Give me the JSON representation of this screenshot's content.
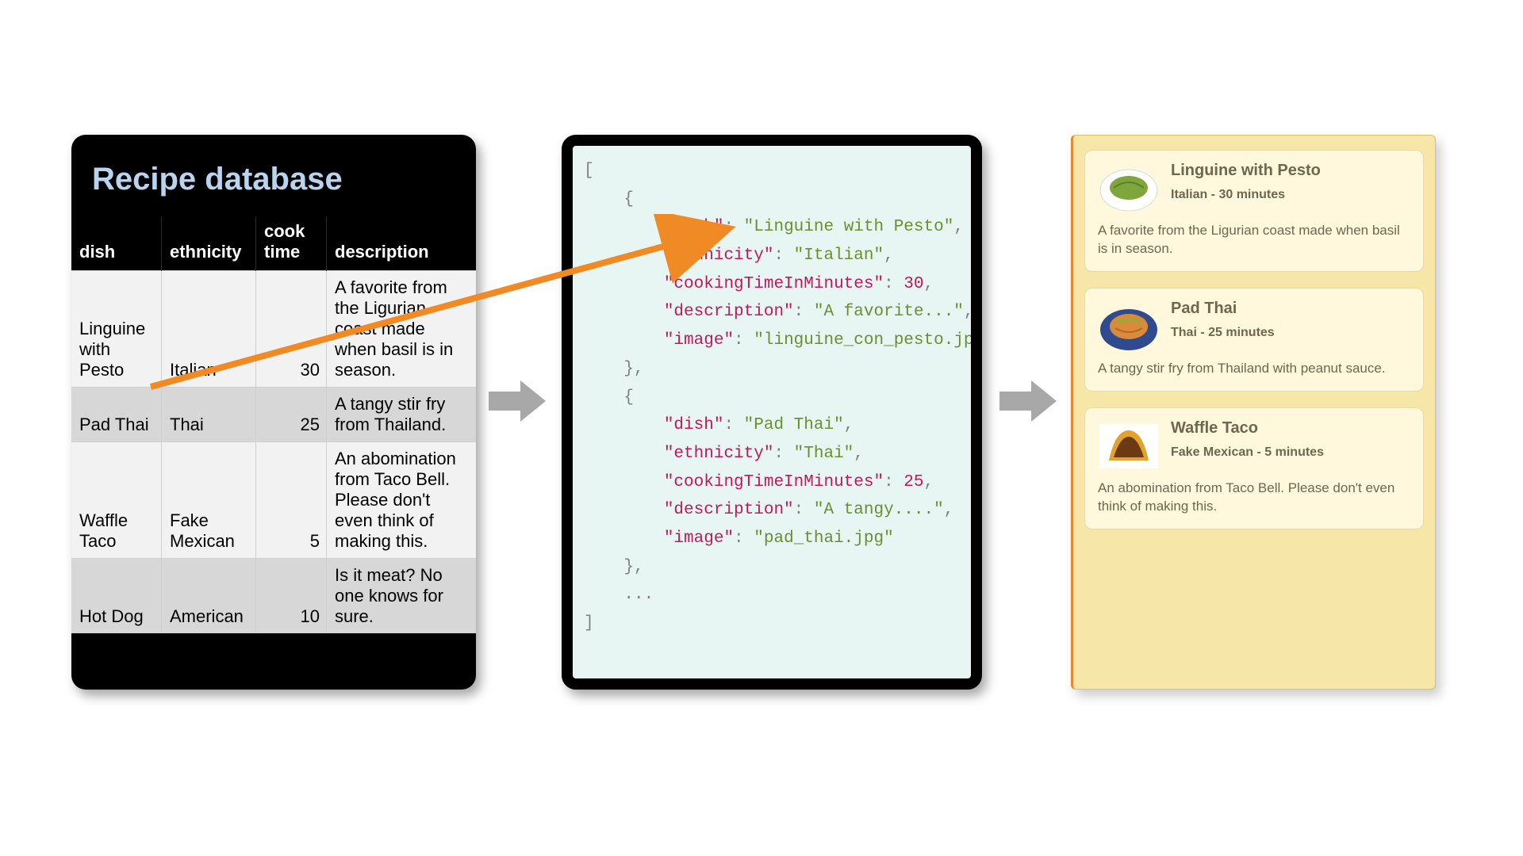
{
  "db": {
    "title": "Recipe database",
    "cols": {
      "dish": "dish",
      "ethnicity": "ethnicity",
      "time": "cook time",
      "desc": "description"
    },
    "rows": [
      {
        "dish": "Linguine with Pesto",
        "ethnicity": "Italian",
        "time": "30",
        "desc": "A favorite from the Ligurian coast made when basil is in season."
      },
      {
        "dish": "Pad Thai",
        "ethnicity": "Thai",
        "time": "25",
        "desc": "A tangy stir fry from Thailand."
      },
      {
        "dish": "Waffle Taco",
        "ethnicity": "Fake Mexican",
        "time": "5",
        "desc": "An abomination from Taco Bell. Please don't even think of making this."
      },
      {
        "dish": "Hot Dog",
        "ethnicity": "American",
        "time": "10",
        "desc": "Is it meat? No one knows for sure."
      }
    ]
  },
  "json": {
    "open": "[",
    "obrace": "    {",
    "l1k": "\"dish\"",
    "l1c": ": ",
    "l1v": "\"Linguine with Pesto\"",
    "l1e": ",",
    "l2k": "\"ethnicity\"",
    "l2v": "\"Italian\"",
    "l3k": "\"cookingTimeInMinutes\"",
    "l3v": "30",
    "l4k": "\"description\"",
    "l4v": "\"A favorite...\"",
    "l5k": "\"image\"",
    "l5v": "\"linguine_con_pesto.jpg\"",
    "cbrace": "    },",
    "b1": "\"Pad Thai\"",
    "b2": "\"Thai\"",
    "b3": "25",
    "b4": "\"A tangy....\"",
    "b5": "\"pad_thai.jpg\"",
    "dots": "    ...",
    "close": "]"
  },
  "cards": [
    {
      "title": "Linguine with Pesto",
      "sub": "Italian - 30 minutes",
      "desc": "A favorite from the Ligurian coast made when basil is in season."
    },
    {
      "title": "Pad Thai",
      "sub": "Thai - 25 minutes",
      "desc": "A tangy stir fry from Thailand with peanut sauce."
    },
    {
      "title": "Waffle Taco",
      "sub": "Fake Mexican - 5 minutes",
      "desc": "An abomination from Taco Bell. Please don't even think of making this."
    }
  ]
}
